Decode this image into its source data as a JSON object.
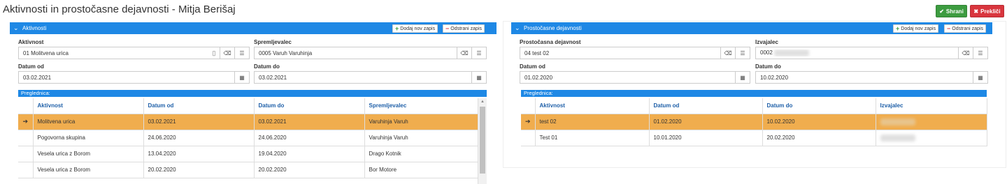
{
  "page": {
    "title": "Aktivnosti in prostočasne dejavnosti - Mitja Berišaj",
    "save_label": "Shrani",
    "cancel_label": "Prekliči",
    "save_color": "#3d9c40",
    "cancel_color": "#d9363e"
  },
  "left": {
    "header": "Aktivnosti",
    "add_label": "Dodaj nov zapis",
    "remove_label": "Odstrani zapis",
    "fields": {
      "aktivnost_label": "Aktivnost",
      "aktivnost_value": "01 Molitvena urica",
      "spremljevalec_label": "Spremljevalec",
      "spremljevalec_value": "0005 Varuh Varuhinja",
      "datum_od_label": "Datum od",
      "datum_od_value": "03.02.2021",
      "datum_do_label": "Datum do",
      "datum_do_value": "03.02.2021"
    },
    "grid_title": "Preglednica:",
    "columns": [
      "Aktivnost",
      "Datum od",
      "Datum do",
      "Spremljevalec"
    ],
    "rows": [
      [
        "Molitvena urica",
        "03.02.2021",
        "03.02.2021",
        "Varuhinja Varuh"
      ],
      [
        "Pogovorna skupina",
        "24.06.2020",
        "24.06.2020",
        "Varuhinja Varuh"
      ],
      [
        "Vesela urica z Borom",
        "13.04.2020",
        "19.04.2020",
        "Drago Kotnik"
      ],
      [
        "Vesela urica z Borom",
        "20.02.2020",
        "20.02.2020",
        "Bor Motore"
      ]
    ],
    "selected_row": 0
  },
  "right": {
    "header": "Prostočasne dejavnosti",
    "add_label": "Dodaj nov zapis",
    "remove_label": "Odstrani zapis",
    "fields": {
      "dejavnost_label": "Prostočasna dejavnost",
      "dejavnost_value": "04 test 02",
      "izvajalec_label": "Izvajalec",
      "izvajalec_value": "0002",
      "datum_od_label": "Datum od",
      "datum_od_value": "01.02.2020",
      "datum_do_label": "Datum do",
      "datum_do_value": "10.02.2020"
    },
    "grid_title": "Preglednica:",
    "columns": [
      "Aktivnost",
      "Datum od",
      "Datum do",
      "Izvajalec"
    ],
    "rows": [
      [
        "test 02",
        "01.02.2020",
        "10.02.2020",
        ""
      ],
      [
        "Test 01",
        "10.01.2020",
        "20.02.2020",
        ""
      ]
    ],
    "selected_row": 0
  },
  "icons": {
    "save": "check-icon",
    "cancel": "times-icon",
    "collapse": "chevron-down-icon",
    "add": "plus-icon",
    "remove": "minus-icon",
    "clear": "eraser-icon",
    "list": "list-icon",
    "calendar": "calendar-icon",
    "row_pointer": "arrow-right-icon"
  },
  "colors": {
    "header_blue": "#1e88e5",
    "selected_row": "#f0ad4e",
    "grid_header_text": "#1e5fa8"
  }
}
